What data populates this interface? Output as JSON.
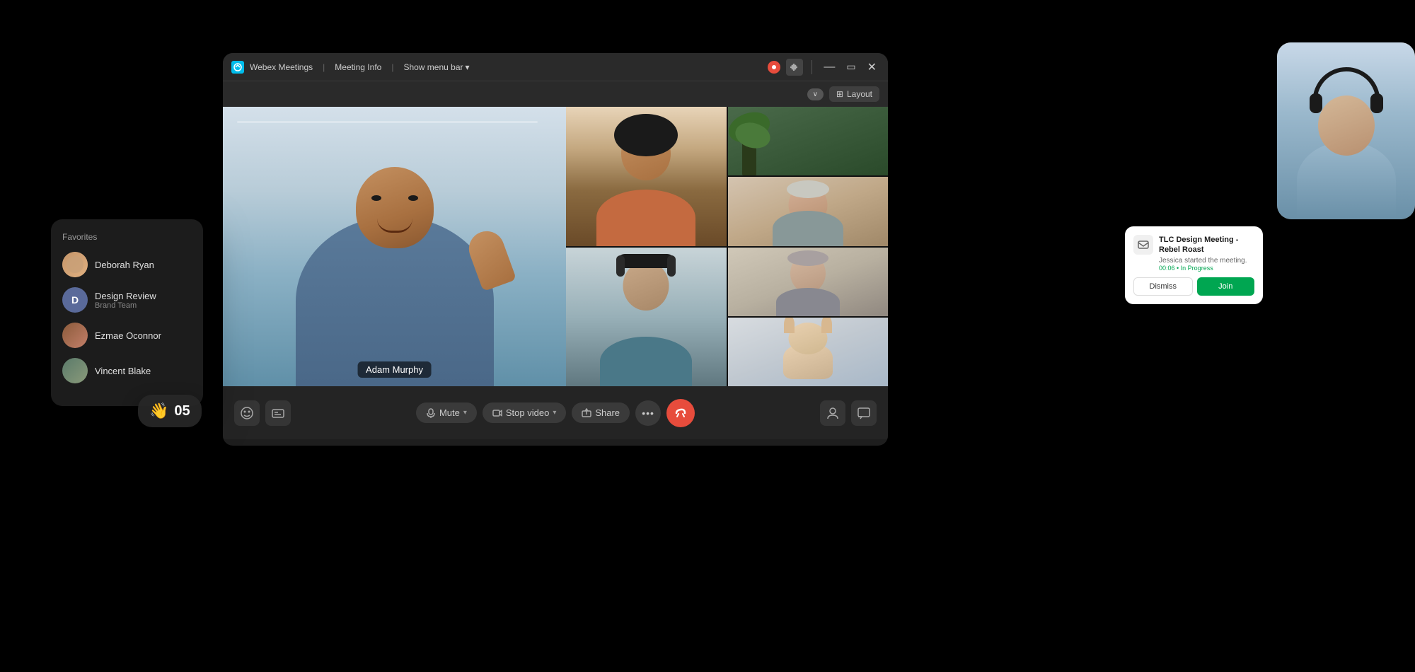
{
  "app": {
    "title": "Webex Meetings",
    "meeting_info": "Meeting Info",
    "show_menu_bar": "Show menu bar"
  },
  "toolbar": {
    "layout_label": "Layout",
    "collapse_label": "∨"
  },
  "speaker": {
    "name": "Adam Murphy"
  },
  "controls": {
    "mute": "Mute",
    "stop_video": "Stop video",
    "share": "Share",
    "more": "•••",
    "end_call": "×"
  },
  "favorites": {
    "title": "Favorites",
    "items": [
      {
        "name": "Deborah Ryan",
        "subtitle": "",
        "avatar_letter": ""
      },
      {
        "name": "Design Review",
        "subtitle": "Brand Team",
        "avatar_letter": "D"
      },
      {
        "name": "Ezmae Oconnor",
        "subtitle": "",
        "avatar_letter": ""
      },
      {
        "name": "Vincent Blake",
        "subtitle": "",
        "avatar_letter": ""
      }
    ]
  },
  "wave": {
    "emoji": "👋",
    "count": "05"
  },
  "notification": {
    "title": "TLC Design Meeting - Rebel Roast",
    "description": "Jessica started the meeting.",
    "status": "00:06 • In Progress",
    "dismiss_label": "Dismiss",
    "join_label": "Join"
  }
}
